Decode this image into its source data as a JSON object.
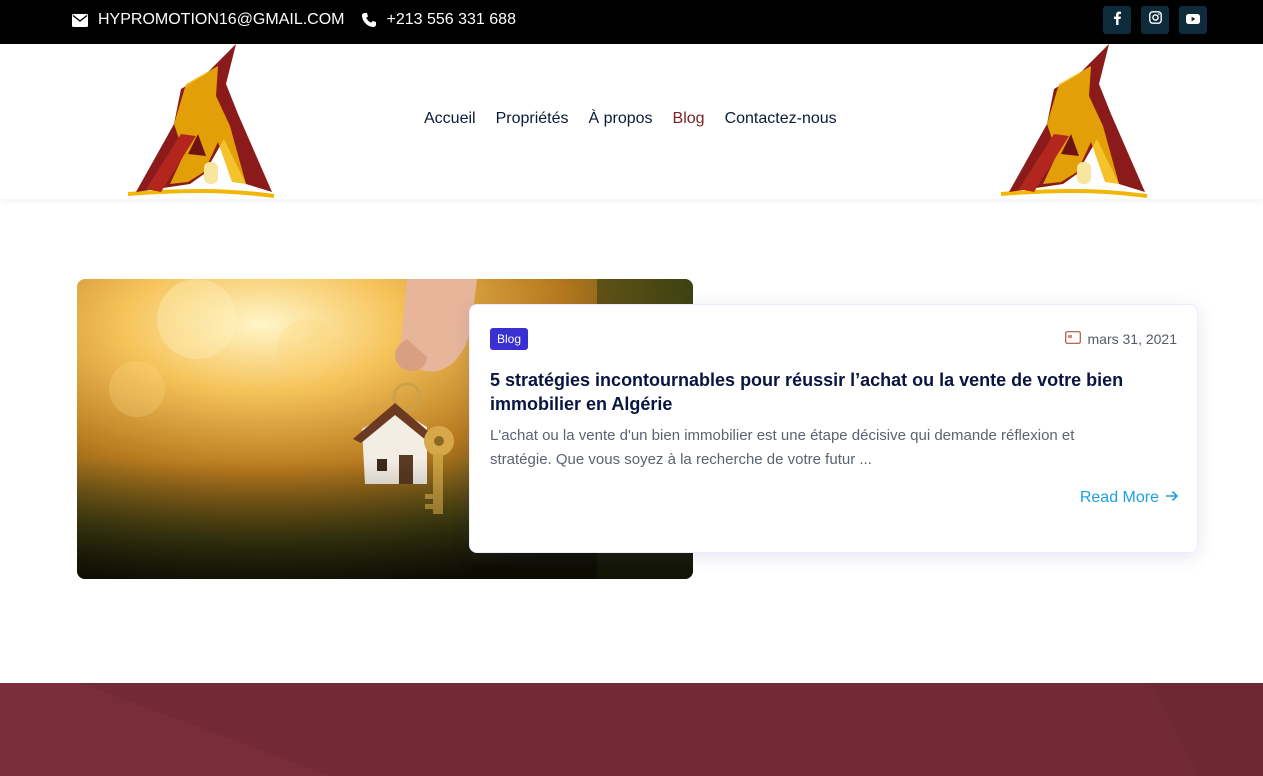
{
  "topbar": {
    "email": "HYPROMOTION16@GMAIL.COM",
    "phone": "+213 556 331 688",
    "social": [
      {
        "icon": "facebook-icon"
      },
      {
        "icon": "instagram-icon"
      },
      {
        "icon": "youtube-icon"
      }
    ]
  },
  "nav": {
    "items": [
      "Accueil",
      "Propriétés",
      "À propos",
      "Blog",
      "Contactez-nous"
    ],
    "active": "Blog"
  },
  "post": {
    "category": "Blog",
    "date": "mars 31, 2021",
    "title": "5 stratégies incontournables pour réussir l’achat ou la vente de votre bien immobilier en Algérie",
    "excerpt": "L'achat ou la vente d'un bien immobilier est une étape décisive qui demande réflexion et stratégie. Que vous soyez à la recherche de votre futur ...",
    "read_more": "Read More"
  },
  "colors": {
    "topbar_bg": "#000000",
    "brand_red": "#7a2228",
    "badge": "#3a2fd0",
    "link": "#1aa3e0",
    "footer_band": "#722a36"
  }
}
